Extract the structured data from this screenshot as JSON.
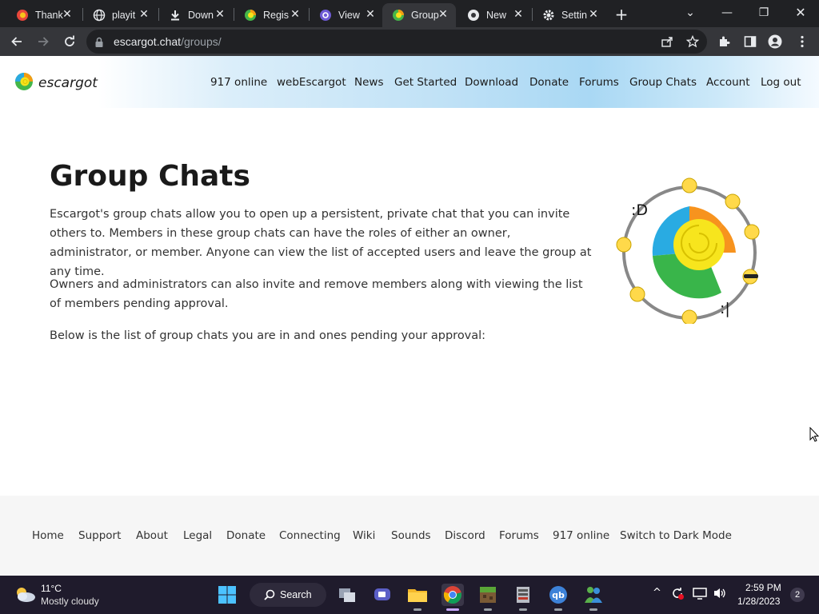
{
  "browser": {
    "tabs": [
      {
        "title": "Thank",
        "icon": "escargot-icon"
      },
      {
        "title": "playit",
        "icon": "globe-icon"
      },
      {
        "title": "Down",
        "icon": "download-icon"
      },
      {
        "title": "Regis",
        "icon": "escargot-icon"
      },
      {
        "title": "View",
        "icon": "at-icon"
      },
      {
        "title": "Group",
        "icon": "escargot-icon",
        "active": true
      },
      {
        "title": "New",
        "icon": "chrome-icon"
      },
      {
        "title": "Settin",
        "icon": "gear-icon"
      }
    ],
    "url_host": "escargot.chat",
    "url_path": "/groups/"
  },
  "site": {
    "logo_text": "escargot",
    "nav": [
      "917 online",
      "webEscargot",
      "News",
      "Get Started",
      "Download",
      "Donate",
      "Forums",
      "Group Chats",
      "Account",
      "Log out"
    ]
  },
  "page": {
    "title": "Group Chats",
    "paragraphs": [
      "Escargot's group chats allow you to open up a persistent, private chat that you can invite others to. Members in these group chats can have the roles of either an owner, administrator, or member. Anyone can view the list of accepted users and leave the group at any time.",
      "Owners and administrators can also invite and remove members along with viewing the list of members pending approval.",
      "Below is the list of group chats you are in and ones pending your approval:"
    ],
    "wheel_text_1": ":D",
    "wheel_text_2": ":|"
  },
  "footer": {
    "links": [
      "Home",
      "Support",
      "About",
      "Legal",
      "Donate",
      "Connecting",
      "Wiki",
      "Sounds",
      "Discord",
      "Forums",
      "917 online",
      "Switch to Dark Mode"
    ]
  },
  "taskbar": {
    "weather_temp": "11°C",
    "weather_desc": "Mostly cloudy",
    "search_label": "Search",
    "time": "2:59 PM",
    "date": "1/28/2023",
    "notifications": "2"
  }
}
